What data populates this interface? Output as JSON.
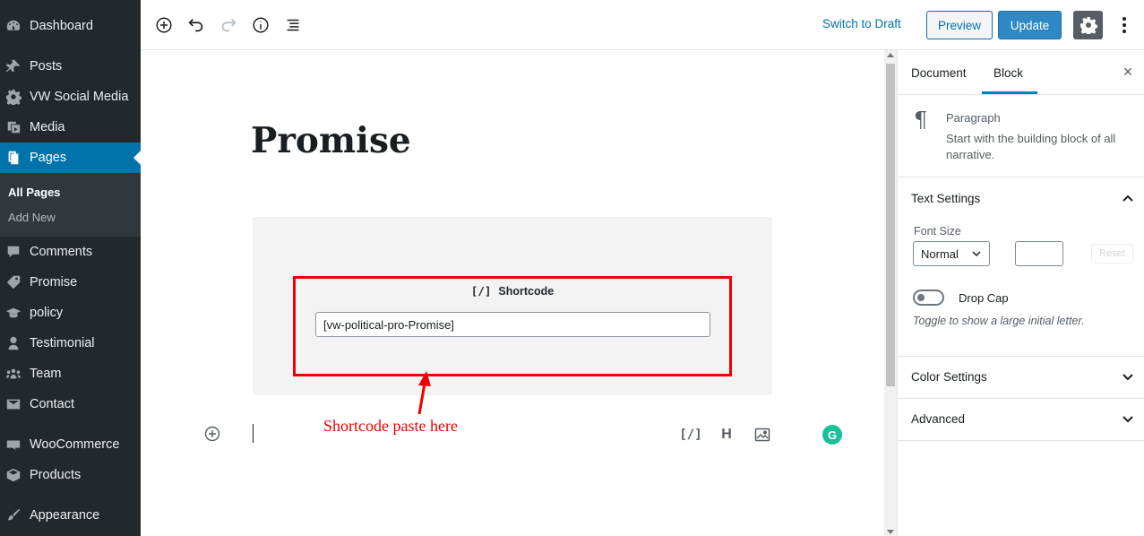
{
  "sidebar": {
    "items": [
      {
        "label": "Dashboard",
        "icon": "dashboard-icon"
      },
      {
        "label": "Posts",
        "icon": "pin-icon"
      },
      {
        "label": "VW Social Media",
        "icon": "gear-icon"
      },
      {
        "label": "Media",
        "icon": "media-icon"
      },
      {
        "label": "Pages",
        "icon": "pages-icon"
      },
      {
        "label": "Comments",
        "icon": "comment-icon"
      },
      {
        "label": "Promise",
        "icon": "tag-icon"
      },
      {
        "label": "policy",
        "icon": "graduation-cap-icon"
      },
      {
        "label": "Testimonial",
        "icon": "person-icon"
      },
      {
        "label": "Team",
        "icon": "group-icon"
      },
      {
        "label": "Contact",
        "icon": "envelope-icon"
      },
      {
        "label": "WooCommerce",
        "icon": "woo-icon"
      },
      {
        "label": "Products",
        "icon": "box-icon"
      },
      {
        "label": "Appearance",
        "icon": "brush-icon"
      }
    ],
    "submenu": [
      "All Pages",
      "Add New"
    ]
  },
  "toolbar": {
    "switch_draft": "Switch to Draft",
    "preview": "Preview",
    "update": "Update"
  },
  "editor": {
    "title": "Promise",
    "shortcode_label": "Shortcode",
    "shortcode_bracket": "[/]",
    "shortcode_value": "[vw-political-pro-Promise]",
    "annotation": "Shortcode paste here",
    "quick_heading": "H",
    "quick_shortcode": "[/]",
    "grammarly": "G"
  },
  "settings": {
    "tabs": [
      "Document",
      "Block"
    ],
    "active_tab": "Block",
    "close": "×",
    "block_title": "Paragraph",
    "block_desc": "Start with the building block of all narrative.",
    "text_settings": "Text Settings",
    "font_size_label": "Font Size",
    "font_size_value": "Normal",
    "reset": "Reset",
    "drop_cap": "Drop Cap",
    "drop_cap_help": "Toggle to show a large initial letter.",
    "color_settings": "Color Settings",
    "advanced": "Advanced"
  },
  "colors": {
    "admin_bg": "#23282d",
    "active_menu": "#0073aa",
    "update_button": "#2d88c4",
    "annotation_red": "#ee0000"
  }
}
